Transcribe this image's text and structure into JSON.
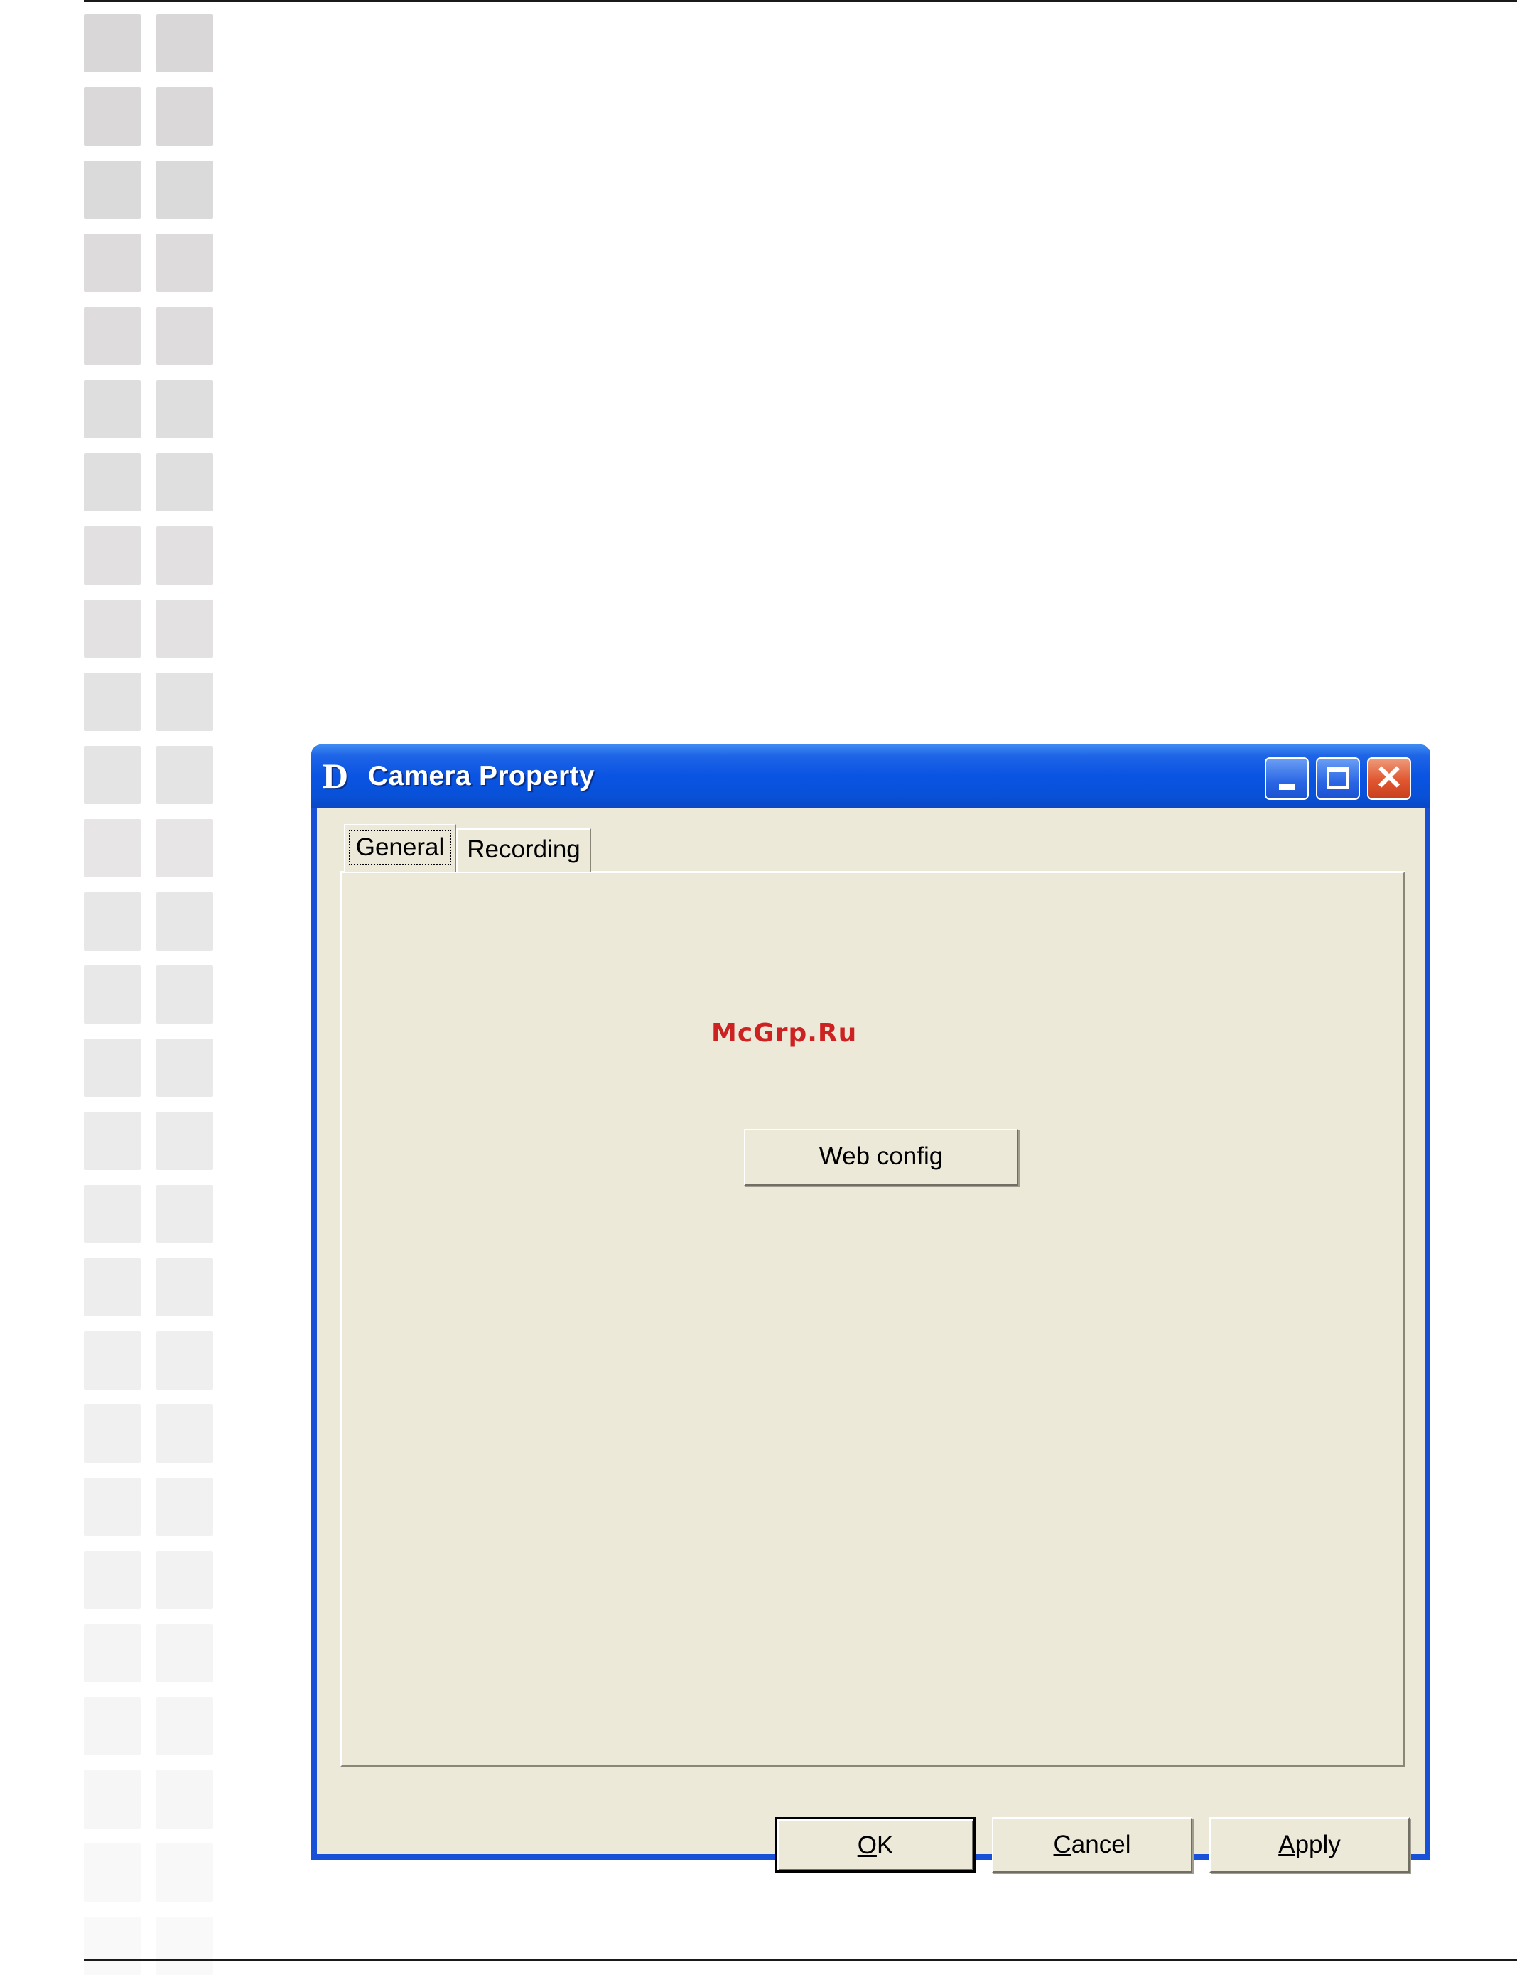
{
  "window": {
    "title": "Camera Property",
    "icon": "dlink-d-icon",
    "icon_letter": "D",
    "controls": {
      "minimize": "minimize-icon",
      "maximize": "maximize-icon",
      "close": "close-icon",
      "close_glyph": "✕"
    }
  },
  "tabs": [
    {
      "label": "General",
      "selected": true
    },
    {
      "label": "Recording",
      "selected": false
    }
  ],
  "general_tab": {
    "web_config_label": "Web config"
  },
  "watermark": "McGrp.Ru",
  "buttons": {
    "ok": {
      "accel": "O",
      "rest": "K"
    },
    "cancel": {
      "accel": "C",
      "rest": "ancel"
    },
    "apply": {
      "accel": "A",
      "rest": "pply"
    }
  },
  "colors": {
    "titlebar_blue": "#0a54e3",
    "dialog_face": "#ece9d8",
    "close_red": "#e0562f",
    "watermark_red": "#cc2222",
    "sidebar_square_dark": "#d9d7d7",
    "sidebar_square_light": "#f7f7f7"
  }
}
